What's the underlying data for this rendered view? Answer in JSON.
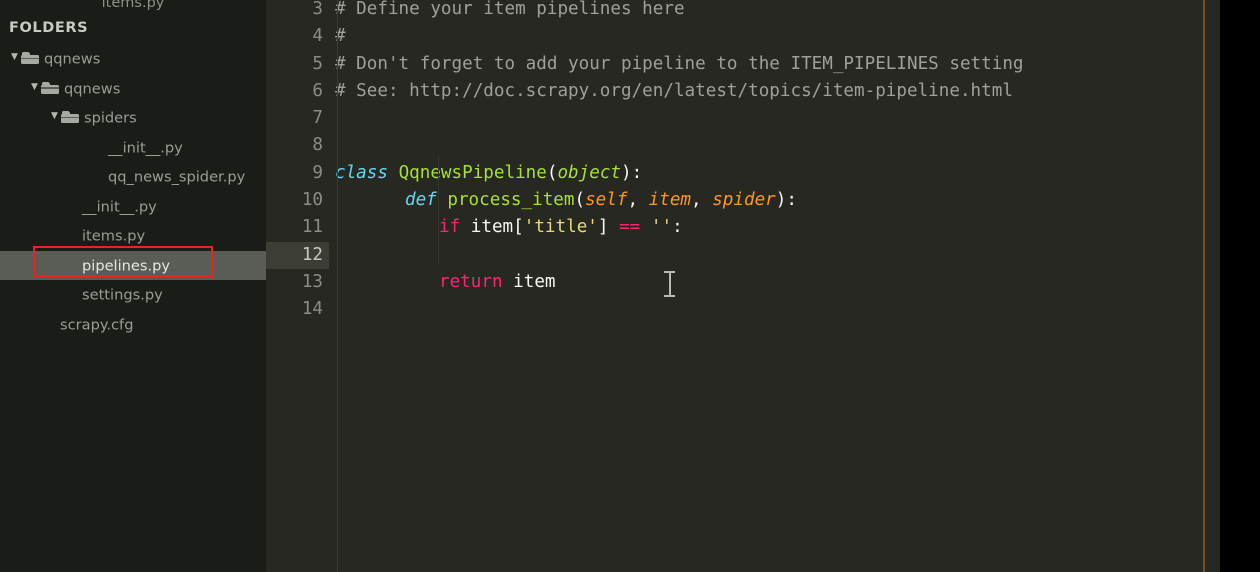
{
  "window": {
    "theme_name": "monokai",
    "colors": {
      "sidebar_bg": "#1a1c18",
      "editor_bg": "#272822",
      "selection_bg": "#5a5c56",
      "highlight_box": "#ef2020",
      "ruler": "#7a4a22",
      "gutter_text": "#8b8d84",
      "comment": "#9fa09a",
      "keyword": "#66d9ef",
      "function": "#a6e22e",
      "parameter": "#fd971f",
      "operator_keyword": "#f92672",
      "string": "#e6db74",
      "plain_text": "#f8f8f2"
    }
  },
  "tabbar": {
    "clipped_tab_label": "items.py"
  },
  "sidebar": {
    "heading": "FOLDERS",
    "items": [
      {
        "label": "qqnews",
        "type": "folder",
        "depth": 0,
        "expanded": true,
        "arrow": "▼",
        "selected": false
      },
      {
        "label": "qqnews",
        "type": "folder",
        "depth": 1,
        "expanded": true,
        "arrow": "▼",
        "selected": false
      },
      {
        "label": "spiders",
        "type": "folder",
        "depth": 2,
        "expanded": true,
        "arrow": "▼",
        "selected": false
      },
      {
        "label": "__init__.py",
        "type": "file",
        "depth": 3,
        "expanded": false,
        "arrow": "",
        "selected": false
      },
      {
        "label": "qq_news_spider.py",
        "type": "file",
        "depth": 3,
        "expanded": false,
        "arrow": "",
        "selected": false
      },
      {
        "label": "__init__.py",
        "type": "file",
        "depth": 2,
        "expanded": false,
        "arrow": "",
        "selected": false
      },
      {
        "label": "items.py",
        "type": "file",
        "depth": 2,
        "expanded": false,
        "arrow": "",
        "selected": false
      },
      {
        "label": "pipelines.py",
        "type": "file",
        "depth": 2,
        "expanded": false,
        "arrow": "",
        "selected": true
      },
      {
        "label": "settings.py",
        "type": "file",
        "depth": 2,
        "expanded": false,
        "arrow": "",
        "selected": false
      },
      {
        "label": "scrapy.cfg",
        "type": "file",
        "depth": 1,
        "expanded": false,
        "arrow": "",
        "selected": false
      }
    ],
    "annotation": {
      "shape": "rectangle",
      "color": "#ef2020",
      "targets_item_label": "pipelines.py"
    }
  },
  "editor": {
    "active_line_number": 12,
    "first_visible_line": 3,
    "lines": [
      {
        "n": "3",
        "text": "# Define your item pipelines here"
      },
      {
        "n": "4",
        "text": "#"
      },
      {
        "n": "5",
        "text": "# Don't forget to add your pipeline to the ITEM_PIPELINES setting"
      },
      {
        "n": "6",
        "text": "# See: http://doc.scrapy.org/en/latest/topics/item-pipeline.html"
      },
      {
        "n": "7",
        "text": ""
      },
      {
        "n": "8",
        "text": ""
      },
      {
        "n": "9",
        "text": "class QqnewsPipeline(object):"
      },
      {
        "n": "10",
        "text": "    def process_item(self, item, spider):"
      },
      {
        "n": "11",
        "text": "        if item['title'] == '':"
      },
      {
        "n": "12",
        "text": ""
      },
      {
        "n": "13",
        "text": "        return item"
      },
      {
        "n": "14",
        "text": ""
      }
    ],
    "tokens": {
      "l3": {
        "comment": "# Define your item pipelines here"
      },
      "l4": {
        "comment": "#"
      },
      "l5": {
        "comment": "# Don't forget to add your pipeline to the ITEM_PIPELINES setting"
      },
      "l6": {
        "comment": "# See: http://doc.scrapy.org/en/latest/topics/item-pipeline.html"
      },
      "l9": {
        "kw": "class",
        "name": "QqnewsPipeline",
        "open": "(",
        "base": "object",
        "close": "):"
      },
      "l10": {
        "kw": "def",
        "name": "process_item",
        "open": "(",
        "p1": "self",
        "sep1": ", ",
        "p2": "item",
        "sep2": ", ",
        "p3": "spider",
        "close": "):"
      },
      "l11": {
        "kw": "if",
        "var": "item",
        "lb": "[",
        "str1": "'title'",
        "rb": "]",
        "op": "==",
        "str2": "''",
        "colon": ":"
      },
      "l13": {
        "kw": "return",
        "var": "item"
      }
    },
    "ruler_column_marker": true,
    "text_cursor": {
      "visible": true,
      "shape": "I-beam"
    }
  }
}
